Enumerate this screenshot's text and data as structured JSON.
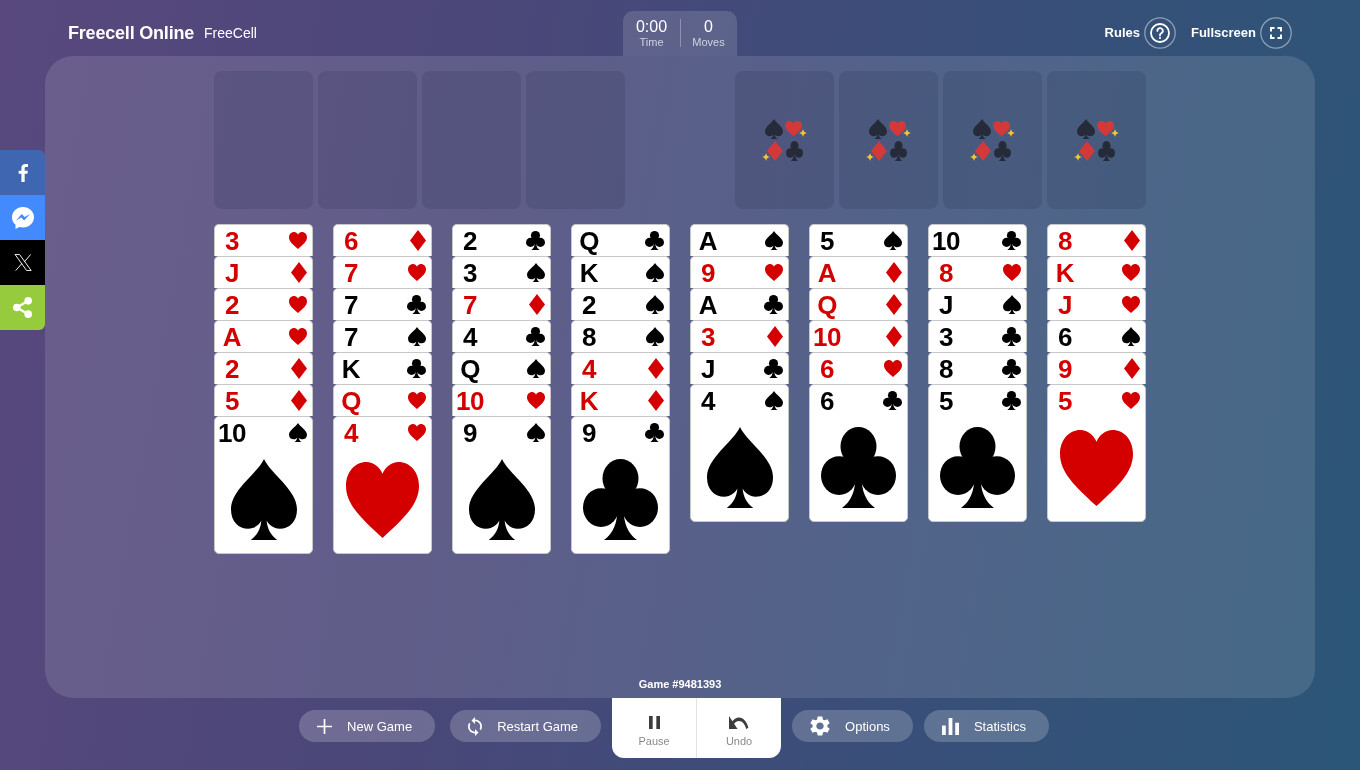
{
  "header": {
    "title": "Freecell Online",
    "subtitle": "FreeCell",
    "counters": [
      {
        "value": "0:00",
        "label": "Time"
      },
      {
        "value": "0",
        "label": "Moves"
      }
    ],
    "links": [
      {
        "label": "Rules",
        "kind": "rules"
      },
      {
        "label": "Fullscreen",
        "kind": "fullscreen"
      }
    ]
  },
  "share_buttons": [
    {
      "kind": "facebook"
    },
    {
      "kind": "messenger"
    },
    {
      "kind": "x"
    },
    {
      "kind": "share"
    }
  ],
  "board": {
    "free_cells": [
      {
        "kind": "empty"
      },
      {
        "kind": "empty"
      },
      {
        "kind": "empty"
      },
      {
        "kind": "empty"
      }
    ],
    "foundations": [
      {
        "kind": "empty"
      },
      {
        "kind": "empty"
      },
      {
        "kind": "empty"
      },
      {
        "kind": "empty"
      }
    ],
    "tableau": [
      {
        "cards": [
          {
            "rank": "3",
            "kind": "hearts"
          },
          {
            "rank": "J",
            "kind": "diamonds"
          },
          {
            "rank": "2",
            "kind": "hearts"
          },
          {
            "rank": "A",
            "kind": "hearts"
          },
          {
            "rank": "2",
            "kind": "diamonds"
          },
          {
            "rank": "5",
            "kind": "diamonds"
          },
          {
            "rank": "10",
            "kind": "spades"
          }
        ]
      },
      {
        "cards": [
          {
            "rank": "6",
            "kind": "diamonds"
          },
          {
            "rank": "7",
            "kind": "hearts"
          },
          {
            "rank": "7",
            "kind": "clubs"
          },
          {
            "rank": "7",
            "kind": "spades"
          },
          {
            "rank": "K",
            "kind": "clubs"
          },
          {
            "rank": "Q",
            "kind": "hearts"
          },
          {
            "rank": "4",
            "kind": "hearts"
          }
        ]
      },
      {
        "cards": [
          {
            "rank": "2",
            "kind": "clubs"
          },
          {
            "rank": "3",
            "kind": "spades"
          },
          {
            "rank": "7",
            "kind": "diamonds"
          },
          {
            "rank": "4",
            "kind": "clubs"
          },
          {
            "rank": "Q",
            "kind": "spades"
          },
          {
            "rank": "10",
            "kind": "hearts"
          },
          {
            "rank": "9",
            "kind": "spades"
          }
        ]
      },
      {
        "cards": [
          {
            "rank": "Q",
            "kind": "clubs"
          },
          {
            "rank": "K",
            "kind": "spades"
          },
          {
            "rank": "2",
            "kind": "spades"
          },
          {
            "rank": "8",
            "kind": "spades"
          },
          {
            "rank": "4",
            "kind": "diamonds"
          },
          {
            "rank": "K",
            "kind": "diamonds"
          },
          {
            "rank": "9",
            "kind": "clubs"
          }
        ]
      },
      {
        "cards": [
          {
            "rank": "A",
            "kind": "spades"
          },
          {
            "rank": "9",
            "kind": "hearts"
          },
          {
            "rank": "A",
            "kind": "clubs"
          },
          {
            "rank": "3",
            "kind": "diamonds"
          },
          {
            "rank": "J",
            "kind": "clubs"
          },
          {
            "rank": "4",
            "kind": "spades"
          }
        ]
      },
      {
        "cards": [
          {
            "rank": "5",
            "kind": "spades"
          },
          {
            "rank": "A",
            "kind": "diamonds"
          },
          {
            "rank": "Q",
            "kind": "diamonds"
          },
          {
            "rank": "10",
            "kind": "diamonds"
          },
          {
            "rank": "6",
            "kind": "hearts"
          },
          {
            "rank": "6",
            "kind": "clubs"
          }
        ]
      },
      {
        "cards": [
          {
            "rank": "10",
            "kind": "clubs"
          },
          {
            "rank": "8",
            "kind": "hearts"
          },
          {
            "rank": "J",
            "kind": "spades"
          },
          {
            "rank": "3",
            "kind": "clubs"
          },
          {
            "rank": "8",
            "kind": "clubs"
          },
          {
            "rank": "5",
            "kind": "clubs"
          }
        ]
      },
      {
        "cards": [
          {
            "rank": "8",
            "kind": "diamonds"
          },
          {
            "rank": "K",
            "kind": "hearts"
          },
          {
            "rank": "J",
            "kind": "hearts"
          },
          {
            "rank": "6",
            "kind": "spades"
          },
          {
            "rank": "9",
            "kind": "diamonds"
          },
          {
            "rank": "5",
            "kind": "hearts"
          }
        ]
      }
    ],
    "game_number": "Game #9481393"
  },
  "toolbar": {
    "left": [
      {
        "kind": "new",
        "label": "New Game"
      },
      {
        "kind": "restart",
        "label": "Restart Game"
      }
    ],
    "center": [
      {
        "kind": "pause",
        "label": "Pause"
      },
      {
        "kind": "undo",
        "label": "Undo"
      }
    ],
    "right": [
      {
        "kind": "options",
        "label": "Options"
      },
      {
        "kind": "statistics",
        "label": "Statistics"
      }
    ]
  }
}
